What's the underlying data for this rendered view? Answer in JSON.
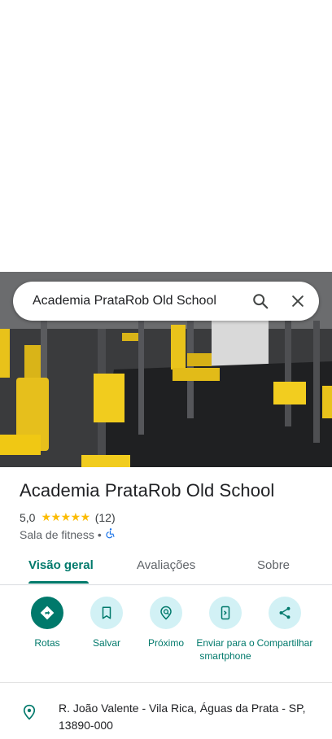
{
  "search": {
    "query": "Academia PrataRob Old School",
    "search_icon": "search-icon",
    "close_icon": "close-icon"
  },
  "place": {
    "name": "Academia PrataRob Old School",
    "rating": "5,0",
    "stars": "★★★★★",
    "review_count": "(12)",
    "category": "Sala de fitness",
    "separator": "•",
    "accessibility_icon": "wheelchair-icon"
  },
  "tabs": [
    {
      "label": "Visão geral",
      "active": true
    },
    {
      "label": "Avaliações",
      "active": false
    },
    {
      "label": "Sobre",
      "active": false
    }
  ],
  "actions": [
    {
      "label": "Rotas",
      "icon": "directions-icon"
    },
    {
      "label": "Salvar",
      "icon": "bookmark-icon"
    },
    {
      "label": "Próximo",
      "icon": "nearby-icon"
    },
    {
      "label": "Enviar para o smartphone",
      "icon": "send-to-phone-icon"
    },
    {
      "label": "Compartilhar",
      "icon": "share-icon"
    }
  ],
  "address": {
    "text": "R. João Valente - Vila Rica, Águas da Prata - SP, 13890-000",
    "icon": "location-pin-icon"
  },
  "colors": {
    "accent": "#00796b",
    "action_bg": "#d2f1f5",
    "star": "#fbbc04",
    "accessibility": "#1a73e8"
  }
}
